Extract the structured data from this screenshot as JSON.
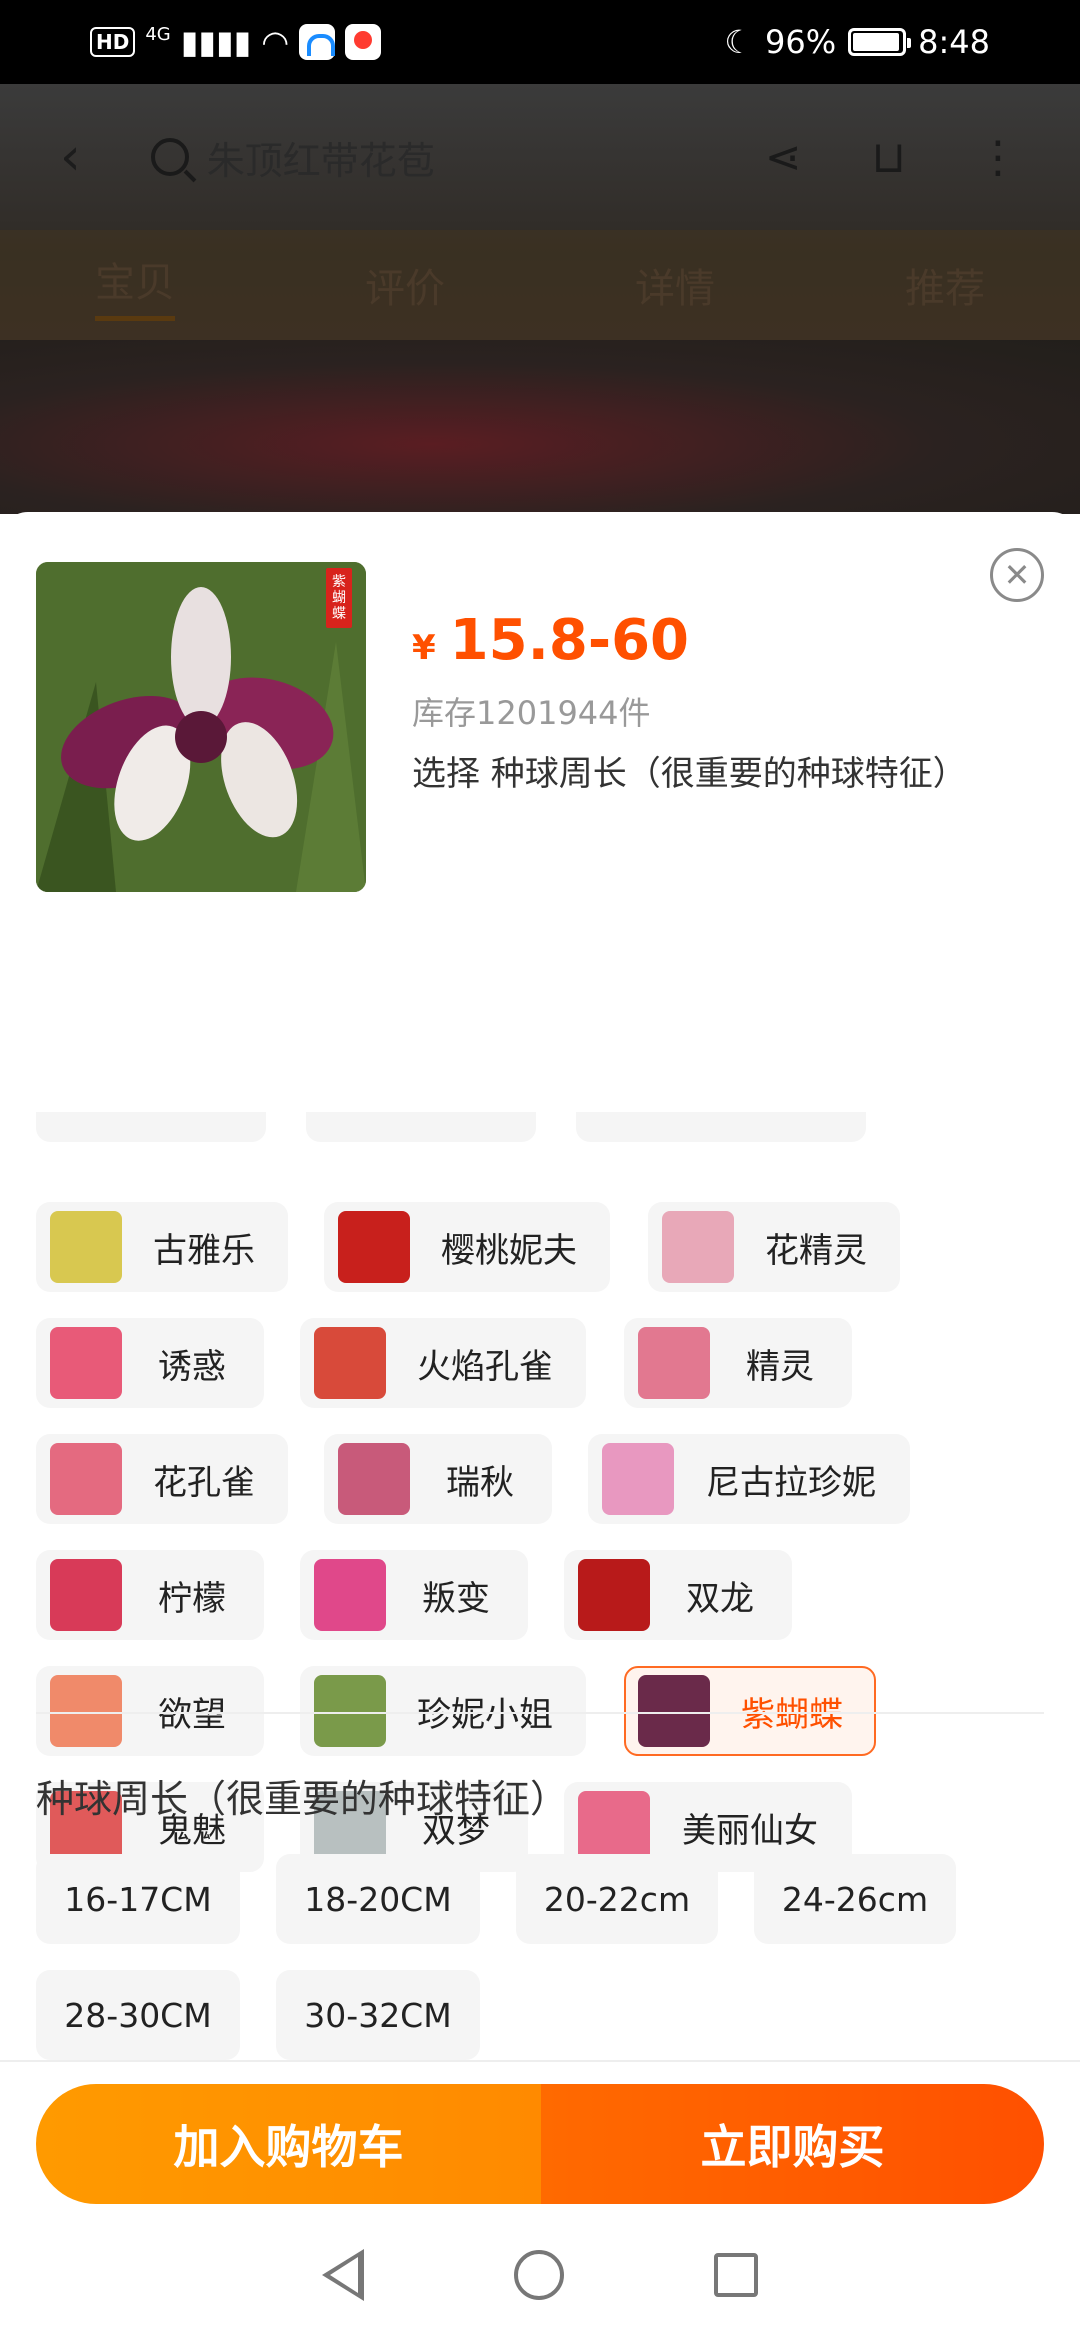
{
  "status_bar": {
    "hd": "HD",
    "network": "4G",
    "battery": "96%",
    "time": "8:48"
  },
  "background_page": {
    "search_text": "朱顶红带花苞",
    "tabs": [
      "宝贝",
      "评价",
      "详情",
      "推荐"
    ]
  },
  "sku_sheet": {
    "thumb_tag": "紫蝴蝶",
    "currency": "¥",
    "price": "15.8-60",
    "stock": "库存1201944件",
    "select_hint": "选择 种球周长（很重要的种球特征）",
    "varieties": [
      {
        "name": "古雅乐",
        "color": "#d8c850"
      },
      {
        "name": "樱桃妮夫",
        "color": "#c8201c"
      },
      {
        "name": "花精灵",
        "color": "#e8a8b8"
      },
      {
        "name": "诱惑",
        "color": "#e85a78"
      },
      {
        "name": "火焰孔雀",
        "color": "#d84a3a"
      },
      {
        "name": "精灵",
        "color": "#e27890"
      },
      {
        "name": "花孔雀",
        "color": "#e46a80"
      },
      {
        "name": "瑞秋",
        "color": "#c85a7a"
      },
      {
        "name": "尼古拉珍妮",
        "color": "#e898c0"
      },
      {
        "name": "柠檬",
        "color": "#d83a58"
      },
      {
        "name": "叛变",
        "color": "#e0488a"
      },
      {
        "name": "双龙",
        "color": "#b81a1a"
      },
      {
        "name": "欲望",
        "color": "#f08a6a"
      },
      {
        "name": "珍妮小姐",
        "color": "#7a9a4a"
      },
      {
        "name": "紫蝴蝶",
        "color": "#6a2a4a"
      },
      {
        "name": "鬼魅",
        "color": "#e05a5a"
      },
      {
        "name": "双梦",
        "color": "#b8c0c0"
      },
      {
        "name": "美丽仙女",
        "color": "#e86a8a"
      }
    ],
    "selected_variety": "紫蝴蝶",
    "size_section_title": "种球周长（很重要的种球特征）",
    "sizes": [
      "16-17CM",
      "18-20CM",
      "20-22cm",
      "24-26cm",
      "28-30CM",
      "30-32CM"
    ]
  },
  "actions": {
    "add_to_cart": "加入购物车",
    "buy_now": "立即购买"
  },
  "icons": {
    "close": "close-icon",
    "back": "back-icon",
    "share": "share-icon",
    "cart": "cart-icon",
    "more": "more-icon"
  },
  "colors": {
    "accent": "#ff5000",
    "cart_button": "#ff9000",
    "selected_border": "#ff6a22"
  }
}
